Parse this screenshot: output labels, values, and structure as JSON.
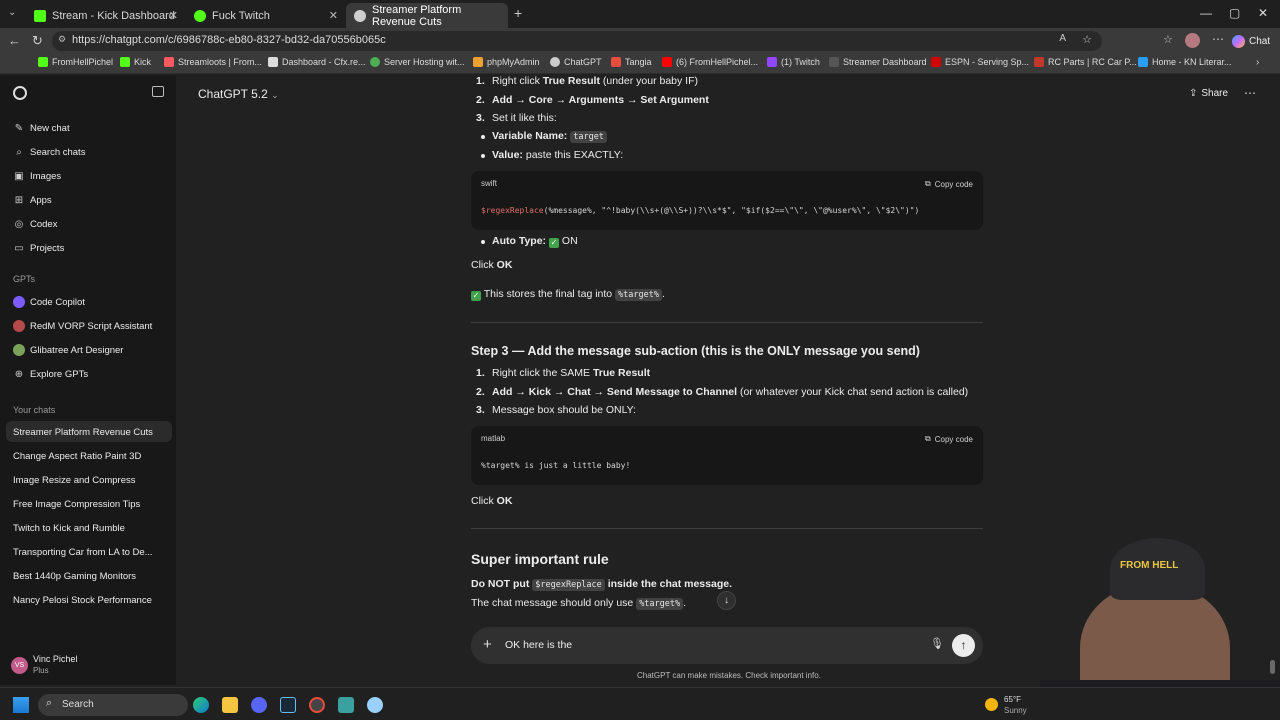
{
  "browser": {
    "tabs": [
      {
        "title": "Stream - Kick Dashboard",
        "fav_color": "#53fc18"
      },
      {
        "title": "Fuck Twitch",
        "fav_color": "#53fc18"
      },
      {
        "title": "Streamer Platform Revenue Cuts",
        "fav_color": "#cccccc"
      }
    ],
    "url": "https://chatgpt.com/c/6986788c-eb80-8327-bd32-da70556b065c",
    "chat_button": "Chat",
    "bookmarks": [
      "FromHellPichel",
      "Kick",
      "Streamloots | From...",
      "Dashboard - Cfx.re...",
      "Server Hosting wit...",
      "phpMyAdmin",
      "ChatGPT",
      "Tangia",
      "(6) FromHellPichel...",
      "(1) Twitch",
      "Streamer Dashboard",
      "ESPN - Serving Sp...",
      "RC Parts | RC Car P...",
      "Home - KN Literar..."
    ]
  },
  "sidebar": {
    "nav": [
      "New chat",
      "Search chats",
      "Images",
      "Apps",
      "Codex",
      "Projects"
    ],
    "gpts_label": "GPTs",
    "gpts": [
      "Code Copilot",
      "RedM VORP Script Assistant",
      "Glibatree Art Designer",
      "Explore GPTs"
    ],
    "your_chats_label": "Your chats",
    "chats": [
      "Streamer Platform Revenue Cuts",
      "Change Aspect Ratio Paint 3D",
      "Image Resize and Compress",
      "Free Image Compression Tips",
      "Twitch to Kick and Rumble",
      "Transporting Car from LA to De...",
      "Best 1440p Gaming Monitors",
      "Nancy Pelosi Stock Performance"
    ],
    "user_name": "Vinc Pichel",
    "user_plan": "Plus",
    "user_initials": "VS"
  },
  "header": {
    "model": "ChatGPT 5.2",
    "share": "Share"
  },
  "content": {
    "s1_n1": "1.",
    "s1_l1a": "Right click ",
    "s1_l1b": "True Result",
    "s1_l1c": " (under your baby IF)",
    "s1_n2": "2.",
    "s1_l2": "Add → Core → Arguments → Set Argument",
    "s1_n3": "3.",
    "s1_l3": "Set it like this:",
    "var_label": "Variable Name:",
    "var_value": "target",
    "value_label": "Value:",
    "value_text": " paste this EXACTLY:",
    "code1_lang": "swift",
    "copy_label": "Copy code",
    "code1_fn": "$regexReplace",
    "code1_rest": "(%message%, \"^!baby(\\\\s+(@\\\\S+))?\\\\s*$\", \"$if($2==\\\"\\\", \\\"@%user%\\\", \\\"$2\\\")\")",
    "autotype_label": "Auto Type:",
    "autotype_value": " ON",
    "click_ok_1a": "Click ",
    "click_ok_1b": "OK",
    "stores_text": " This stores the final tag into ",
    "stores_code": "%target%",
    "stores_end": ".",
    "step3_heading": "Step 3 — Add the message sub-action (this is the ONLY message you send)",
    "s3_n1": "1.",
    "s3_l1a": "Right click the SAME ",
    "s3_l1b": "True Result",
    "s3_n2": "2.",
    "s3_l2a": "Add → Kick → Chat → Send Message to Channel",
    "s3_l2b": " (or whatever your Kick chat send action is called)",
    "s3_n3": "3.",
    "s3_l3": "Message box should be ONLY:",
    "code2_lang": "matlab",
    "code2_text": "%target% is just a little baby!",
    "click_ok_2a": "Click ",
    "click_ok_2b": "OK",
    "rule_heading": "Super important rule",
    "rule1a": "Do NOT put ",
    "rule1_code": "$regexReplace",
    "rule1b": " inside the chat message.",
    "rule2a": "The chat message should only use ",
    "rule2_code": "%target%",
    "rule2b": "."
  },
  "composer": {
    "text": "OK here is the",
    "disclaimer": "ChatGPT can make mistakes. Check important info."
  },
  "taskbar": {
    "search": "Search",
    "temp": "65°F",
    "weather": "Sunny"
  },
  "webcam": {
    "cap_text": "FROM HELL"
  }
}
